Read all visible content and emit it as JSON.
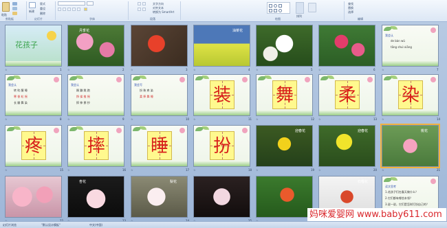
{
  "ribbon": {
    "groups": [
      "剪贴板",
      "幻灯片",
      "字体",
      "段落",
      "绘图",
      "编辑"
    ],
    "labels": [
      "粘贴",
      "新建",
      "幻灯片",
      "版式",
      "重设",
      "删除",
      "文字方向",
      "对齐文本",
      "转换为 SmartArt",
      "查找",
      "替换",
      "选择",
      "排列",
      "快速样式"
    ]
  },
  "slides": [
    {
      "num": "1",
      "kind": "title",
      "title": "花孩子"
    },
    {
      "num": "2",
      "kind": "photo",
      "label": "月季花"
    },
    {
      "num": "3",
      "kind": "photo",
      "label": ""
    },
    {
      "num": "4",
      "kind": "photo",
      "label": "油菜花"
    },
    {
      "num": "5",
      "kind": "photo",
      "label": ""
    },
    {
      "num": "6",
      "kind": "photo",
      "label": ""
    },
    {
      "num": "7",
      "kind": "pinyin",
      "title": "我会认",
      "lines": [
        "de  bàn  wǔ",
        "tāng  shuì  xiāng"
      ]
    },
    {
      "num": "8",
      "kind": "words",
      "title": "我会认",
      "lines": [
        "转  吹  醒  睡",
        "寒  香  粒  摇",
        "长  瓣  舞  染"
      ]
    },
    {
      "num": "9",
      "kind": "words",
      "title": "我会认",
      "lines": [
        "踢  蹦  跳  跑",
        "挣  揉  推  摇",
        "探  伸  挪  抄"
      ]
    },
    {
      "num": "10",
      "kind": "words",
      "title": "我会写",
      "lines": [
        "扮  装  疼  染",
        "柔  摔  舞  睡"
      ]
    },
    {
      "num": "11",
      "kind": "char",
      "char": "装"
    },
    {
      "num": "12",
      "kind": "char",
      "char": "舞"
    },
    {
      "num": "13",
      "kind": "char",
      "char": "柔"
    },
    {
      "num": "14",
      "kind": "char",
      "char": "染"
    },
    {
      "num": "15",
      "kind": "char",
      "char": "疼"
    },
    {
      "num": "16",
      "kind": "char",
      "char": "摔"
    },
    {
      "num": "17",
      "kind": "char",
      "char": "睡"
    },
    {
      "num": "18",
      "kind": "char",
      "char": "扮"
    },
    {
      "num": "19",
      "kind": "photo",
      "label": "迎春花"
    },
    {
      "num": "20",
      "kind": "photo",
      "label": "迎春花"
    },
    {
      "num": "21",
      "kind": "photo",
      "label": "桃花"
    },
    {
      "num": "22",
      "kind": "photo",
      "label": ""
    },
    {
      "num": "23",
      "kind": "photo",
      "label": "杏花"
    },
    {
      "num": "24",
      "kind": "photo",
      "label": "梨花"
    },
    {
      "num": "25",
      "kind": "photo",
      "label": ""
    },
    {
      "num": "26",
      "kind": "photo",
      "label": ""
    },
    {
      "num": "27",
      "kind": "photo",
      "label": "石榴花"
    },
    {
      "num": "28",
      "kind": "text",
      "title": "读文思考",
      "lines": [
        "1.花孩子们在春天做什么？",
        "2.它们都有哪些本领？",
        "3.说一说，它们是怎样打扮自己的？"
      ]
    }
  ],
  "colors": {
    "accent": "#d8201a",
    "selection": "#f2b33d",
    "background": "#a9bfdc"
  },
  "status": {
    "slides": "幻灯片浏览",
    "theme": "\"默认设计模板\"",
    "lang": "中文(中国)"
  },
  "watermark": "妈咪爱婴网 www.baby611.com"
}
